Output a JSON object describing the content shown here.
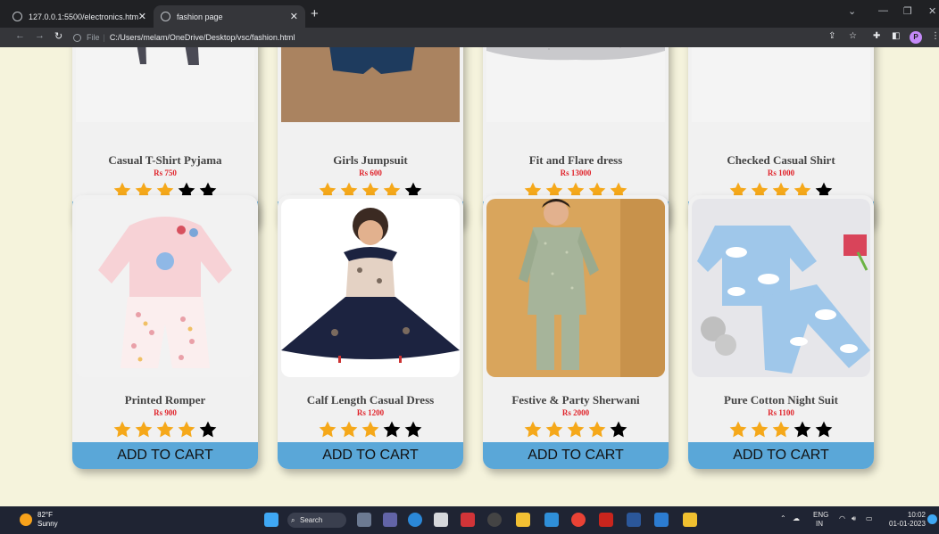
{
  "browser": {
    "tabs": [
      {
        "title": "127.0.0.1:5500/electronics.html",
        "active": false
      },
      {
        "title": "fashion page",
        "active": true
      }
    ],
    "address": {
      "label": "File",
      "url": "C:/Users/melam/OneDrive/Desktop/vsc/fashion.html"
    },
    "profile_initial": "P"
  },
  "products": [
    {
      "name": "Casual T-Shirt Pyjama",
      "price": "Rs 750",
      "rating": 3,
      "art": "pyjama"
    },
    {
      "name": "Girls Jumpsuit",
      "price": "Rs 600",
      "rating": 4,
      "art": "jumpsuit"
    },
    {
      "name": "Fit and Flare dress",
      "price": "Rs 13000",
      "rating": 5,
      "art": "tutu"
    },
    {
      "name": "Checked Casual Shirt",
      "price": "Rs 1000",
      "rating": 4,
      "art": "shirt"
    },
    {
      "name": "Printed Romper",
      "price": "Rs 900",
      "rating": 4,
      "art": "romper"
    },
    {
      "name": "Calf Length Casual Dress",
      "price": "Rs 1200",
      "rating": 3,
      "art": "dress"
    },
    {
      "name": "Festive & Party Sherwani",
      "price": "Rs 2000",
      "rating": 4,
      "art": "sherwani"
    },
    {
      "name": "Pure Cotton Night Suit",
      "price": "Rs 1100",
      "rating": 3,
      "art": "nightsuit"
    }
  ],
  "cart_label": "ADD TO CART",
  "colors": {
    "star_on": "#f5a81a",
    "star_off": "#000000",
    "cart_button": "#5aa7d8",
    "price": "#e0242b",
    "page_bg": "#f5f3dc"
  },
  "taskbar": {
    "weather_temp": "82°F",
    "weather_desc": "Sunny",
    "search_label": "Search",
    "lang_top": "ENG",
    "lang_bottom": "IN",
    "time": "10:02",
    "date": "01-01-2023"
  }
}
